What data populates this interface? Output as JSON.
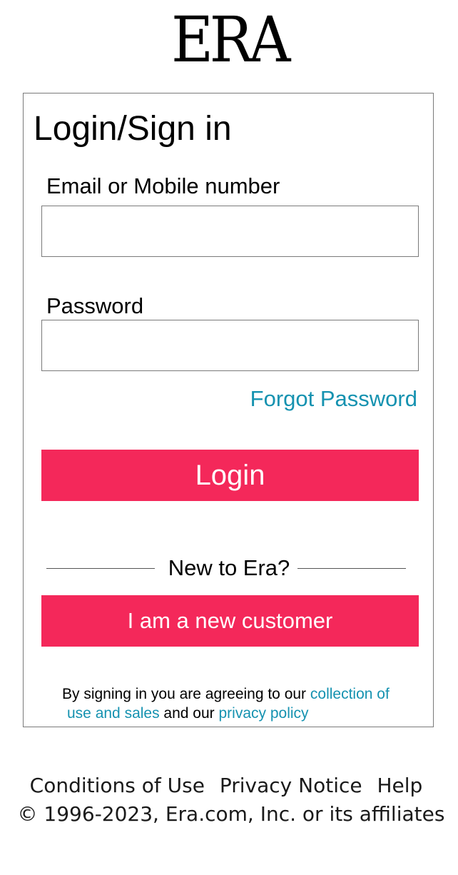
{
  "brand": {
    "logo_text": "ERA"
  },
  "login_card": {
    "title": "Login/Sign in",
    "email_label": "Email or Mobile number",
    "email_value": "",
    "email_placeholder": "",
    "password_label": "Password",
    "password_value": "",
    "password_placeholder": "",
    "forgot_password": "Forgot Password",
    "login_button": "Login",
    "divider_text": "New to Era?",
    "new_customer_button": "I am a new customer",
    "terms": {
      "prefix": "By signing in you are agreeing to our ",
      "link1_part1": "collection of",
      "link1_part2": "use and sales",
      "middle": " and our ",
      "link2": "privacy policy"
    }
  },
  "footer": {
    "links": [
      "Conditions of Use",
      "Privacy Notice",
      "Help"
    ],
    "copyright": "© 1996-2023, Era.com, Inc. or its affiliates"
  },
  "colors": {
    "accent": "#f4285a",
    "link": "#1592b0",
    "border": "#7a7a7a"
  }
}
